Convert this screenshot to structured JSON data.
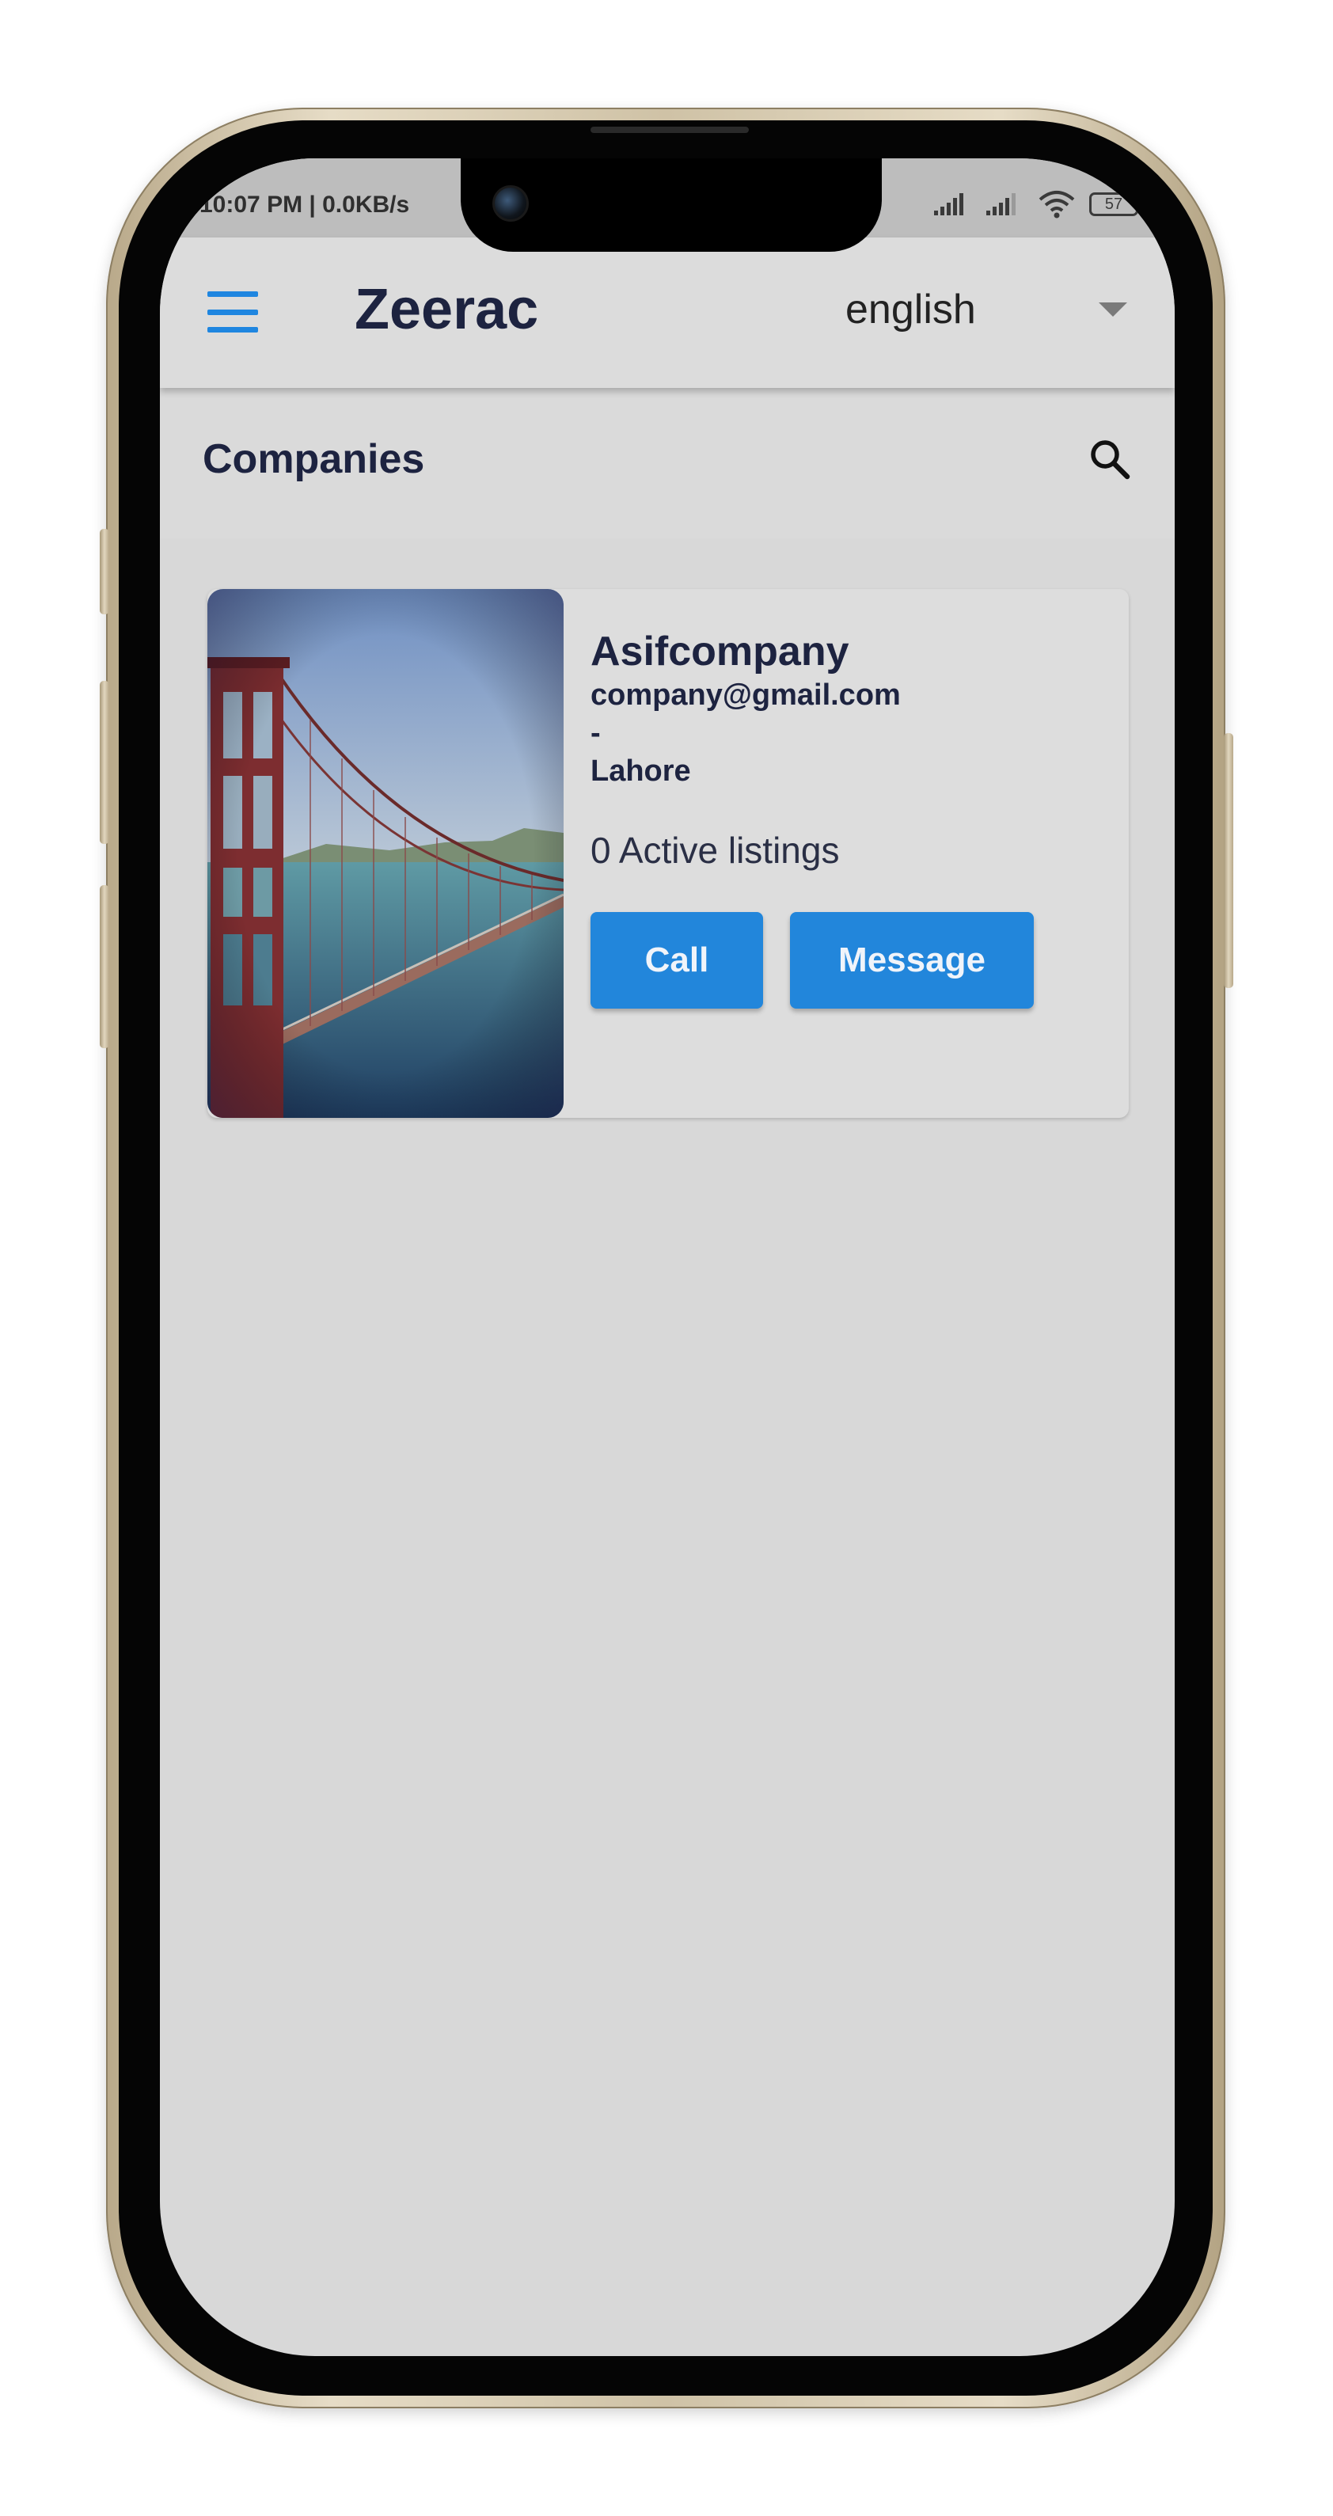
{
  "status_bar": {
    "time_speed": "10:07 PM | 0.0KB/s",
    "battery_level": "57",
    "icons": [
      "signal-icon",
      "signal-icon",
      "wifi-icon",
      "battery-icon"
    ]
  },
  "app_bar": {
    "menu_icon": "hamburger-menu-icon",
    "title": "Zeerac",
    "language": {
      "selected": "english",
      "icon": "caret-down-icon"
    }
  },
  "section": {
    "title": "Companies",
    "search_icon": "search-icon"
  },
  "companies": [
    {
      "name": "Asifcompany",
      "email": "company@gmail.com",
      "phone": "-",
      "city": "Lahore",
      "listings": "0 Active listings",
      "image": "golden-gate-bridge-photo",
      "call_label": "Call",
      "message_label": "Message"
    }
  ],
  "colors": {
    "accent": "#2286db",
    "title_text": "#1d2340",
    "screen_bg": "#d8d8d8",
    "app_bar_bg": "#dcdcdc",
    "status_bar_bg": "#bdbdbd"
  }
}
